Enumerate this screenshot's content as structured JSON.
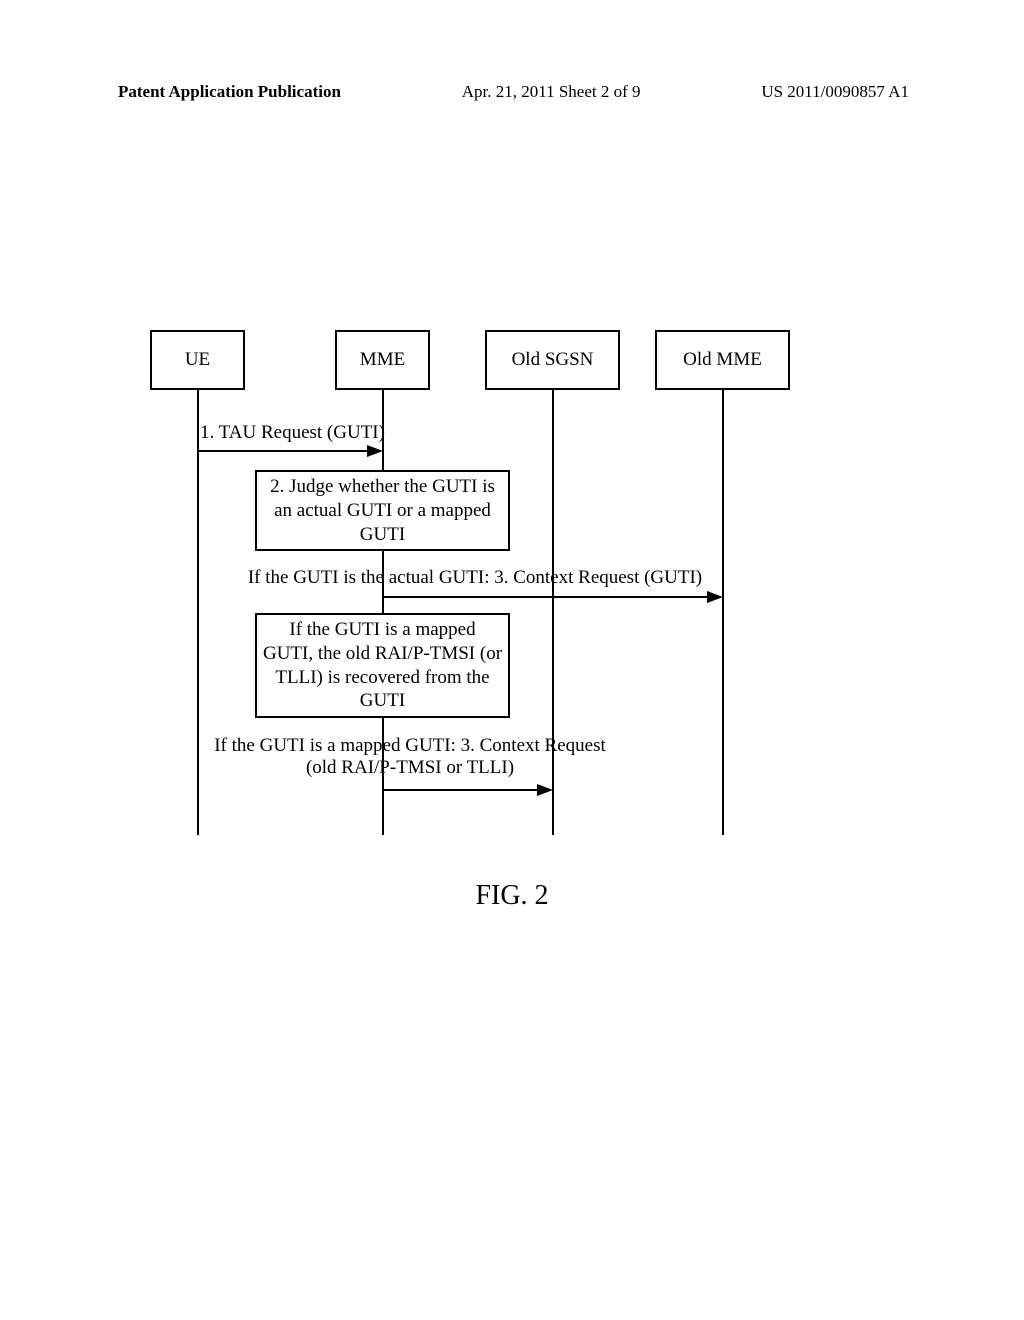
{
  "header": {
    "left": "Patent Application Publication",
    "center": "Apr. 21, 2011  Sheet 2 of 9",
    "right": "US 2011/0090857 A1"
  },
  "actors": {
    "ue": "UE",
    "mme": "MME",
    "oldsgsn": "Old SGSN",
    "oldmme": "Old MME"
  },
  "messages": {
    "msg1": "1. TAU Request (GUTI)",
    "note2": "2. Judge whether the GUTI is an actual GUTI or a mapped GUTI",
    "msg3a": "If the GUTI is the actual GUTI: 3. Context Request (GUTI)",
    "note3b": "If the GUTI is a mapped GUTI, the old RAI/P-TMSI (or TLLI) is recovered from the GUTI",
    "msg3c_line1": "If the GUTI is a mapped GUTI: 3. Context Request",
    "msg3c_line2": "(old RAI/P-TMSI or TLLI)"
  },
  "figure_label": "FIG. 2",
  "chart_data": {
    "type": "sequence_diagram",
    "actors": [
      "UE",
      "MME",
      "Old SGSN",
      "Old MME"
    ],
    "steps": [
      {
        "from": "UE",
        "to": "MME",
        "label": "1. TAU Request (GUTI)"
      },
      {
        "at": "MME",
        "type": "note",
        "label": "2. Judge whether the GUTI is an actual GUTI or a mapped GUTI"
      },
      {
        "from": "MME",
        "to": "Old MME",
        "condition": "If the GUTI is the actual GUTI",
        "label": "3. Context Request (GUTI)"
      },
      {
        "at": "MME",
        "type": "note",
        "condition": "If the GUTI is a mapped GUTI",
        "label": "the old RAI/P-TMSI (or TLLI) is recovered from the GUTI"
      },
      {
        "from": "MME",
        "to": "Old SGSN",
        "condition": "If the GUTI is a mapped GUTI",
        "label": "3. Context Request (old RAI/P-TMSI or TLLI)"
      }
    ]
  }
}
